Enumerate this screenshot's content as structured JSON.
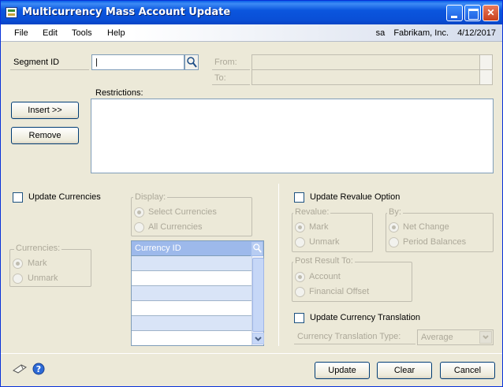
{
  "window": {
    "title": "Multicurrency Mass Account Update"
  },
  "menu": {
    "file": "File",
    "edit": "Edit",
    "tools": "Tools",
    "help": "Help",
    "user": "sa",
    "company": "Fabrikam, Inc.",
    "date": "4/12/2017"
  },
  "segment": {
    "label": "Segment ID",
    "value": "|",
    "from_label": "From:",
    "to_label": "To:"
  },
  "restrictions": {
    "label": "Restrictions:",
    "insert_button": "Insert >>",
    "remove_button": "Remove"
  },
  "update_currencies": {
    "label": "Update Currencies",
    "checked": false
  },
  "display": {
    "title": "Display:",
    "options": [
      "Select Currencies",
      "All Currencies"
    ],
    "selected": "Select Currencies"
  },
  "currencies": {
    "title": "Currencies:",
    "options": [
      "Mark",
      "Unmark"
    ],
    "selected": "Mark"
  },
  "grid": {
    "header": "Currency ID",
    "rows": [
      "",
      "",
      "",
      "",
      "",
      ""
    ]
  },
  "revalue_option": {
    "label": "Update Revalue Option",
    "checked": false,
    "revalue_title": "Revalue:",
    "revalue_options": [
      "Mark",
      "Unmark"
    ],
    "revalue_selected": "Mark",
    "by_title": "By:",
    "by_options": [
      "Net Change",
      "Period Balances"
    ],
    "by_selected": "Net Change",
    "post_title": "Post Result To:",
    "post_options": [
      "Account",
      "Financial Offset"
    ],
    "post_selected": "Account"
  },
  "currency_translation": {
    "label": "Update Currency Translation",
    "checked": false,
    "type_label": "Currency Translation Type:",
    "type_value": "Average"
  },
  "footer": {
    "update_button": "Update",
    "clear_button": "Clear",
    "cancel_button": "Cancel"
  }
}
